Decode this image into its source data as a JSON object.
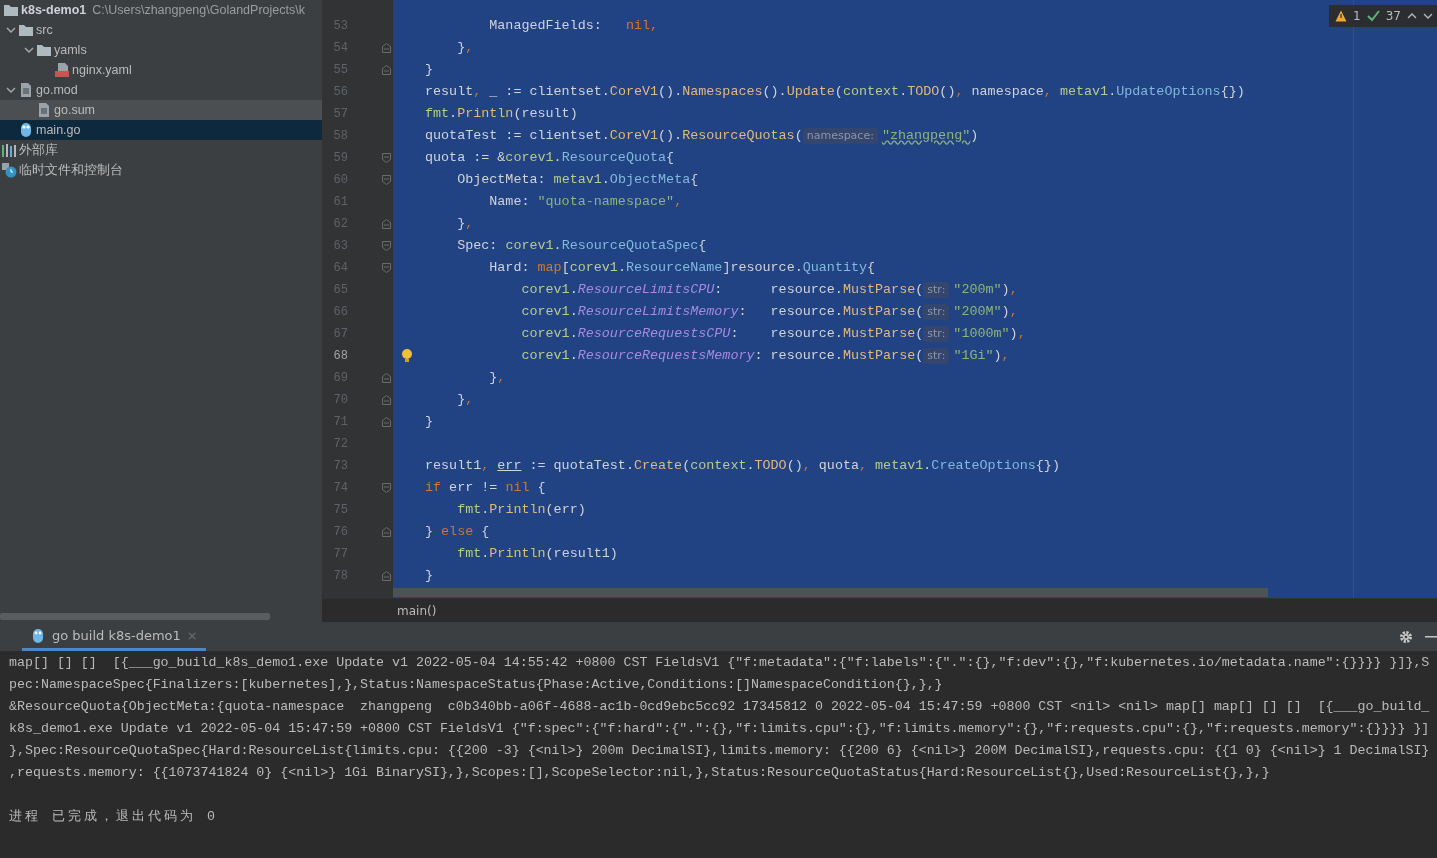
{
  "project": {
    "root": {
      "name": "k8s-demo1",
      "path": "C:\\Users\\zhangpeng\\GolandProjects\\k"
    },
    "tree": [
      {
        "name": "src",
        "kind": "folder",
        "expanded": true,
        "selected": false,
        "hovered": false,
        "children": [
          {
            "name": "yamls",
            "kind": "folder",
            "expanded": true,
            "selected": false,
            "hovered": false,
            "children": [
              {
                "name": "nginx.yaml",
                "kind": "yaml",
                "selected": false,
                "hovered": false
              }
            ]
          }
        ]
      },
      {
        "name": "go.mod",
        "kind": "file",
        "expanded": true,
        "selected": false,
        "hovered": false,
        "children": [
          {
            "name": "go.sum",
            "kind": "file",
            "selected": false,
            "hovered": true
          }
        ]
      },
      {
        "name": "main.go",
        "kind": "go",
        "selected": true,
        "hovered": false
      }
    ],
    "extras": [
      {
        "name": "外部库",
        "kind": "library"
      },
      {
        "name": "临时文件和控制台",
        "kind": "scratch"
      }
    ]
  },
  "editor": {
    "inspections": {
      "warnings": "1",
      "weak_warnings": "37"
    },
    "lines": [
      {
        "number": "53",
        "tokens": [
          {
            "kind": "id",
            "text": "\t\tManagedFields:   "
          },
          {
            "kind": "kw",
            "text": "nil,"
          }
        ]
      },
      {
        "number": "54",
        "fold_end": true,
        "tokens": [
          {
            "kind": "id",
            "text": "\t}"
          },
          {
            "kind": "kw",
            "text": ","
          }
        ]
      },
      {
        "number": "55",
        "fold_end": true,
        "tokens": [
          {
            "kind": "id",
            "text": "}"
          }
        ]
      },
      {
        "number": "56",
        "tokens": [
          {
            "kind": "id",
            "text": "result"
          },
          {
            "kind": "kw",
            "text": ","
          },
          {
            "kind": "id",
            "text": " _ := clientset."
          },
          {
            "kind": "fn",
            "text": "CoreV1"
          },
          {
            "kind": "id",
            "text": "()."
          },
          {
            "kind": "fn",
            "text": "Namespaces"
          },
          {
            "kind": "id",
            "text": "()."
          },
          {
            "kind": "fn",
            "text": "Update"
          },
          {
            "kind": "id",
            "text": "("
          },
          {
            "kind": "pkg",
            "text": "context"
          },
          {
            "kind": "id",
            "text": "."
          },
          {
            "kind": "fn",
            "text": "TODO"
          },
          {
            "kind": "id",
            "text": "()"
          },
          {
            "kind": "kw",
            "text": ","
          },
          {
            "kind": "id",
            "text": " namespace"
          },
          {
            "kind": "kw",
            "text": ","
          },
          {
            "kind": "pkg",
            "text": " metav1"
          },
          {
            "kind": "id",
            "text": "."
          },
          {
            "kind": "type",
            "text": "UpdateOptions"
          },
          {
            "kind": "id",
            "text": "{})"
          }
        ]
      },
      {
        "number": "57",
        "tokens": [
          {
            "kind": "pkg",
            "text": "fmt"
          },
          {
            "kind": "id",
            "text": "."
          },
          {
            "kind": "fn",
            "text": "Println"
          },
          {
            "kind": "id",
            "text": "(result)"
          }
        ]
      },
      {
        "number": "58",
        "tokens": [
          {
            "kind": "id",
            "text": "quotaTest := clientset."
          },
          {
            "kind": "fn",
            "text": "CoreV1"
          },
          {
            "kind": "id",
            "text": "()."
          },
          {
            "kind": "fn",
            "text": "ResourceQuotas"
          },
          {
            "kind": "id",
            "text": "("
          },
          {
            "kind": "hint",
            "text": "namespace:"
          },
          {
            "kind": "wavy",
            "text": "\"zhangpeng\""
          },
          {
            "kind": "id",
            "text": ")"
          }
        ]
      },
      {
        "number": "59",
        "fold_start": true,
        "tokens": [
          {
            "kind": "id",
            "text": "quota := &"
          },
          {
            "kind": "pkg",
            "text": "corev1"
          },
          {
            "kind": "id",
            "text": "."
          },
          {
            "kind": "type",
            "text": "ResourceQuota"
          },
          {
            "kind": "id",
            "text": "{"
          }
        ]
      },
      {
        "number": "60",
        "fold_start": true,
        "tokens": [
          {
            "kind": "id",
            "text": "\tObjectMeta: "
          },
          {
            "kind": "pkg",
            "text": "metav1"
          },
          {
            "kind": "id",
            "text": "."
          },
          {
            "kind": "type",
            "text": "ObjectMeta"
          },
          {
            "kind": "id",
            "text": "{"
          }
        ]
      },
      {
        "number": "61",
        "tokens": [
          {
            "kind": "id",
            "text": "\t\tName: "
          },
          {
            "kind": "str",
            "text": "\"quota-namespace\""
          },
          {
            "kind": "kw",
            "text": ","
          }
        ]
      },
      {
        "number": "62",
        "fold_end": true,
        "tokens": [
          {
            "kind": "id",
            "text": "\t}"
          },
          {
            "kind": "kw",
            "text": ","
          }
        ]
      },
      {
        "number": "63",
        "fold_start": true,
        "tokens": [
          {
            "kind": "id",
            "text": "\tSpec: "
          },
          {
            "kind": "pkg",
            "text": "corev1"
          },
          {
            "kind": "id",
            "text": "."
          },
          {
            "kind": "type",
            "text": "ResourceQuotaSpec"
          },
          {
            "kind": "id",
            "text": "{"
          }
        ]
      },
      {
        "number": "64",
        "fold_start": true,
        "tokens": [
          {
            "kind": "id",
            "text": "\t\tHard: "
          },
          {
            "kind": "kw",
            "text": "map"
          },
          {
            "kind": "id",
            "text": "["
          },
          {
            "kind": "pkg",
            "text": "corev1"
          },
          {
            "kind": "id",
            "text": "."
          },
          {
            "kind": "type",
            "text": "ResourceName"
          },
          {
            "kind": "id",
            "text": "]resource."
          },
          {
            "kind": "type",
            "text": "Quantity"
          },
          {
            "kind": "id",
            "text": "{"
          }
        ]
      },
      {
        "number": "65",
        "tokens": [
          {
            "kind": "pkg",
            "text": "\t\t\tcorev1"
          },
          {
            "kind": "id",
            "text": "."
          },
          {
            "kind": "const",
            "text": "ResourceLimitsCPU"
          },
          {
            "kind": "id",
            "text": ":      resource."
          },
          {
            "kind": "fn",
            "text": "MustParse"
          },
          {
            "kind": "id",
            "text": "("
          },
          {
            "kind": "hint",
            "text": "str:"
          },
          {
            "kind": "str",
            "text": "\"200m\""
          },
          {
            "kind": "id",
            "text": ")"
          },
          {
            "kind": "kw",
            "text": ","
          }
        ]
      },
      {
        "number": "66",
        "tokens": [
          {
            "kind": "pkg",
            "text": "\t\t\tcorev1"
          },
          {
            "kind": "id",
            "text": "."
          },
          {
            "kind": "const",
            "text": "ResourceLimitsMemory"
          },
          {
            "kind": "id",
            "text": ":   resource."
          },
          {
            "kind": "fn",
            "text": "MustParse"
          },
          {
            "kind": "id",
            "text": "("
          },
          {
            "kind": "hint",
            "text": "str:"
          },
          {
            "kind": "str",
            "text": "\"200M\""
          },
          {
            "kind": "id",
            "text": ")"
          },
          {
            "kind": "kw",
            "text": ","
          }
        ]
      },
      {
        "number": "67",
        "tokens": [
          {
            "kind": "pkg",
            "text": "\t\t\tcorev1"
          },
          {
            "kind": "id",
            "text": "."
          },
          {
            "kind": "const",
            "text": "ResourceRequestsCPU"
          },
          {
            "kind": "id",
            "text": ":    resource."
          },
          {
            "kind": "fn",
            "text": "MustParse"
          },
          {
            "kind": "id",
            "text": "("
          },
          {
            "kind": "hint",
            "text": "str:"
          },
          {
            "kind": "str",
            "text": "\"1000m\""
          },
          {
            "kind": "id",
            "text": ")"
          },
          {
            "kind": "kw",
            "text": ","
          }
        ]
      },
      {
        "number": "68",
        "current": true,
        "bulb": true,
        "tokens": [
          {
            "kind": "pkg",
            "text": "\t\t\tcorev1"
          },
          {
            "kind": "id",
            "text": "."
          },
          {
            "kind": "const",
            "text": "ResourceRequestsMemory"
          },
          {
            "kind": "id",
            "text": ": resource."
          },
          {
            "kind": "fn",
            "text": "MustParse"
          },
          {
            "kind": "id",
            "text": "("
          },
          {
            "kind": "hint",
            "text": "str:"
          },
          {
            "kind": "str",
            "text": "\"1Gi\""
          },
          {
            "kind": "id",
            "text": ")"
          },
          {
            "kind": "kw",
            "text": ","
          }
        ]
      },
      {
        "number": "69",
        "fold_end": true,
        "tokens": [
          {
            "kind": "id",
            "text": "\t\t}"
          },
          {
            "kind": "kw",
            "text": ","
          }
        ]
      },
      {
        "number": "70",
        "fold_end": true,
        "tokens": [
          {
            "kind": "id",
            "text": "\t}"
          },
          {
            "kind": "kw",
            "text": ","
          }
        ]
      },
      {
        "number": "71",
        "fold_end": true,
        "tokens": [
          {
            "kind": "id",
            "text": "}"
          }
        ]
      },
      {
        "number": "72"
      },
      {
        "number": "73",
        "tokens": [
          {
            "kind": "id",
            "text": "result1"
          },
          {
            "kind": "kw",
            "text": ", "
          },
          {
            "kind": "u",
            "text": "err"
          },
          {
            "kind": "id",
            "text": " := quotaTest."
          },
          {
            "kind": "fn",
            "text": "Create"
          },
          {
            "kind": "id",
            "text": "("
          },
          {
            "kind": "pkg",
            "text": "context"
          },
          {
            "kind": "id",
            "text": "."
          },
          {
            "kind": "fn",
            "text": "TODO"
          },
          {
            "kind": "id",
            "text": "()"
          },
          {
            "kind": "kw",
            "text": ","
          },
          {
            "kind": "id",
            "text": " quota"
          },
          {
            "kind": "kw",
            "text": ","
          },
          {
            "kind": "pkg",
            "text": " metav1"
          },
          {
            "kind": "id",
            "text": "."
          },
          {
            "kind": "type",
            "text": "CreateOptions"
          },
          {
            "kind": "id",
            "text": "{})"
          }
        ]
      },
      {
        "number": "74",
        "fold_start": true,
        "tokens": [
          {
            "kind": "kw",
            "text": "if"
          },
          {
            "kind": "id",
            "text": " err != "
          },
          {
            "kind": "kw",
            "text": "nil"
          },
          {
            "kind": "id",
            "text": " {"
          }
        ]
      },
      {
        "number": "75",
        "tokens": [
          {
            "kind": "pkg",
            "text": "\tfmt"
          },
          {
            "kind": "id",
            "text": "."
          },
          {
            "kind": "fn",
            "text": "Println"
          },
          {
            "kind": "id",
            "text": "(err)"
          }
        ]
      },
      {
        "number": "76",
        "fold_end": true,
        "tokens": [
          {
            "kind": "id",
            "text": "} "
          },
          {
            "kind": "kw",
            "text": "else"
          },
          {
            "kind": "id",
            "text": " {"
          }
        ]
      },
      {
        "number": "77",
        "tokens": [
          {
            "kind": "pkg",
            "text": "\tfmt"
          },
          {
            "kind": "id",
            "text": "."
          },
          {
            "kind": "fn",
            "text": "Println"
          },
          {
            "kind": "id",
            "text": "(result1)"
          }
        ]
      },
      {
        "number": "78",
        "fold_end": true,
        "tokens": [
          {
            "kind": "id",
            "text": "}"
          }
        ]
      }
    ],
    "breadcrumb": "main()"
  },
  "run": {
    "tab": {
      "label": "go build k8s-demo1",
      "close": "×"
    },
    "console": [
      {
        "kind": "output",
        "text": "map[] [] []  [{___go_build_k8s_demo1.exe Update v1 2022-05-04 14:55:42 +0800 CST FieldsV1 {\"f:metadata\":{\"f:labels\":{\".\":{},\"f:dev\":{},\"f:kubernetes.io/metadata.name\":{}}}} }]},S"
      },
      {
        "kind": "output",
        "text": "pec:NamespaceSpec{Finalizers:[kubernetes],},Status:NamespaceStatus{Phase:Active,Conditions:[]NamespaceCondition{},},}"
      },
      {
        "kind": "output",
        "text": "&ResourceQuota{ObjectMeta:{quota-namespace  zhangpeng  c0b340bb-a06f-4688-ac1b-0cd9ebc5cc92 17345812 0 2022-05-04 15:47:59 +0800 CST <nil> <nil> map[] map[] [] []  [{___go_build_"
      },
      {
        "kind": "output",
        "text": "k8s_demo1.exe Update v1 2022-05-04 15:47:59 +0800 CST FieldsV1 {\"f:spec\":{\"f:hard\":{\".\":{},\"f:limits.cpu\":{},\"f:limits.memory\":{},\"f:requests.cpu\":{},\"f:requests.memory\":{}}}} }]"
      },
      {
        "kind": "output",
        "text": "},Spec:ResourceQuotaSpec{Hard:ResourceList{limits.cpu: {{200 -3} {<nil>} 200m DecimalSI},limits.memory: {{200 6} {<nil>} 200M DecimalSI},requests.cpu: {{1 0} {<nil>} 1 DecimalSI}"
      },
      {
        "kind": "output",
        "text": ",requests.memory: {{1073741824 0} {<nil>} 1Gi BinarySI},},Scopes:[],ScopeSelector:nil,},Status:ResourceQuotaStatus{Hard:ResourceList{},Used:ResourceList{},},}"
      },
      {
        "kind": "exit",
        "text": "进程 已完成，退出代码为 0"
      }
    ]
  }
}
